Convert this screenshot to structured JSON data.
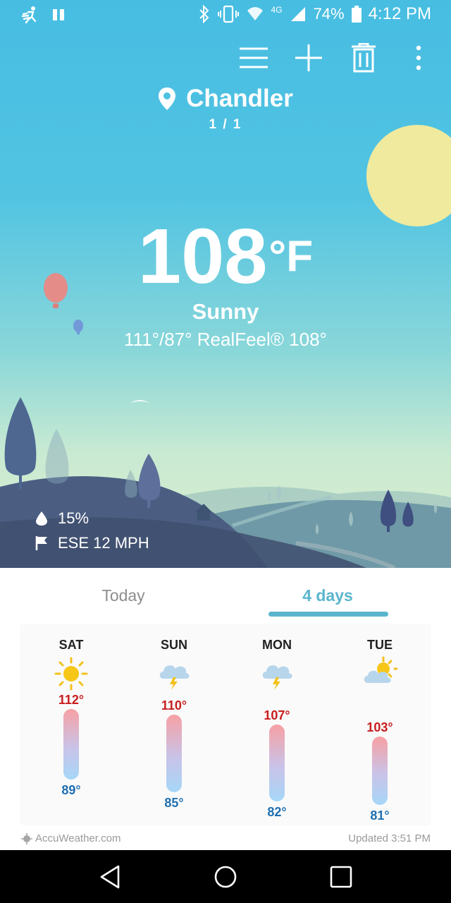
{
  "status_bar": {
    "battery": "74%",
    "clock": "4:12 PM",
    "network": "4G"
  },
  "toolbar": {
    "menu_icon": "hamburger-menu-icon",
    "add_icon": "plus-icon",
    "delete_icon": "trash-icon",
    "more_icon": "more-vertical-icon"
  },
  "location": {
    "city": "Chandler",
    "page_indicator": "1 / 1"
  },
  "current": {
    "temperature": "108",
    "unit": "°F",
    "condition": "Sunny",
    "hilo_realfeel": "111°/87° RealFeel® 108°",
    "precipitation": "15%",
    "wind": "ESE 12 MPH"
  },
  "tabs": {
    "today": "Today",
    "four_days": "4 days",
    "selected": "4 days"
  },
  "forecast": [
    {
      "day": "SAT",
      "icon": "sunny-icon",
      "high": "112°",
      "low": "89°"
    },
    {
      "day": "SUN",
      "icon": "thunderstorm-icon",
      "high": "110°",
      "low": "85°"
    },
    {
      "day": "MON",
      "icon": "thunderstorm-icon",
      "high": "107°",
      "low": "82°"
    },
    {
      "day": "TUE",
      "icon": "partly-sunny-icon",
      "high": "103°",
      "low": "81°"
    }
  ],
  "footer": {
    "brand": "AccuWeather.com",
    "updated": "Updated 3:51 PM"
  },
  "colors": {
    "accent": "#5ab5cd",
    "high_temp": "#c81d1d",
    "low_temp": "#1f6fb0",
    "sun": "#f9ec9a"
  }
}
